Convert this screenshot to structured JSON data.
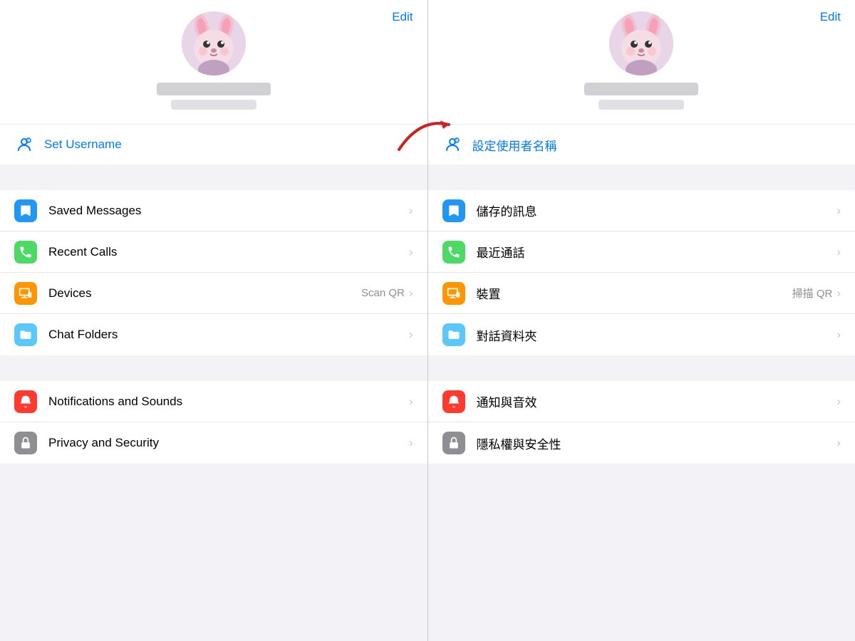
{
  "left": {
    "edit_label": "Edit",
    "username_label": "Set Username",
    "menu_items": [
      {
        "id": "saved-messages",
        "label": "Saved Messages",
        "icon_type": "bookmark",
        "icon_color": "blue",
        "secondary": "",
        "chevron": "›"
      },
      {
        "id": "recent-calls",
        "label": "Recent Calls",
        "icon_type": "phone",
        "icon_color": "green",
        "secondary": "",
        "chevron": "›"
      },
      {
        "id": "devices",
        "label": "Devices",
        "icon_type": "monitor",
        "icon_color": "orange",
        "secondary": "Scan QR",
        "chevron": "›"
      },
      {
        "id": "chat-folders",
        "label": "Chat Folders",
        "icon_type": "folder",
        "icon_color": "teal",
        "secondary": "",
        "chevron": "›"
      }
    ],
    "menu_items2": [
      {
        "id": "notifications",
        "label": "Notifications and Sounds",
        "icon_type": "bell",
        "icon_color": "red",
        "secondary": "",
        "chevron": "›"
      },
      {
        "id": "privacy",
        "label": "Privacy and Security",
        "icon_type": "lock",
        "icon_color": "gray",
        "secondary": "",
        "chevron": "›"
      }
    ]
  },
  "right": {
    "edit_label": "Edit",
    "username_label": "設定使用者名稱",
    "menu_items": [
      {
        "id": "saved-messages-zh",
        "label": "儲存的訊息",
        "icon_type": "bookmark",
        "icon_color": "blue",
        "secondary": "",
        "chevron": "›"
      },
      {
        "id": "recent-calls-zh",
        "label": "最近通話",
        "icon_type": "phone",
        "icon_color": "green",
        "secondary": "",
        "chevron": "›"
      },
      {
        "id": "devices-zh",
        "label": "裝置",
        "icon_type": "monitor",
        "icon_color": "orange",
        "secondary": "掃描 QR",
        "chevron": "›"
      },
      {
        "id": "chat-folders-zh",
        "label": "對話資料夾",
        "icon_type": "folder",
        "icon_color": "teal",
        "secondary": "",
        "chevron": "›"
      }
    ],
    "menu_items2": [
      {
        "id": "notifications-zh",
        "label": "通知與音效",
        "icon_type": "bell",
        "icon_color": "red",
        "secondary": "",
        "chevron": "›"
      },
      {
        "id": "privacy-zh",
        "label": "隱私權與安全性",
        "icon_type": "lock",
        "icon_color": "gray",
        "secondary": "",
        "chevron": "›"
      }
    ]
  }
}
